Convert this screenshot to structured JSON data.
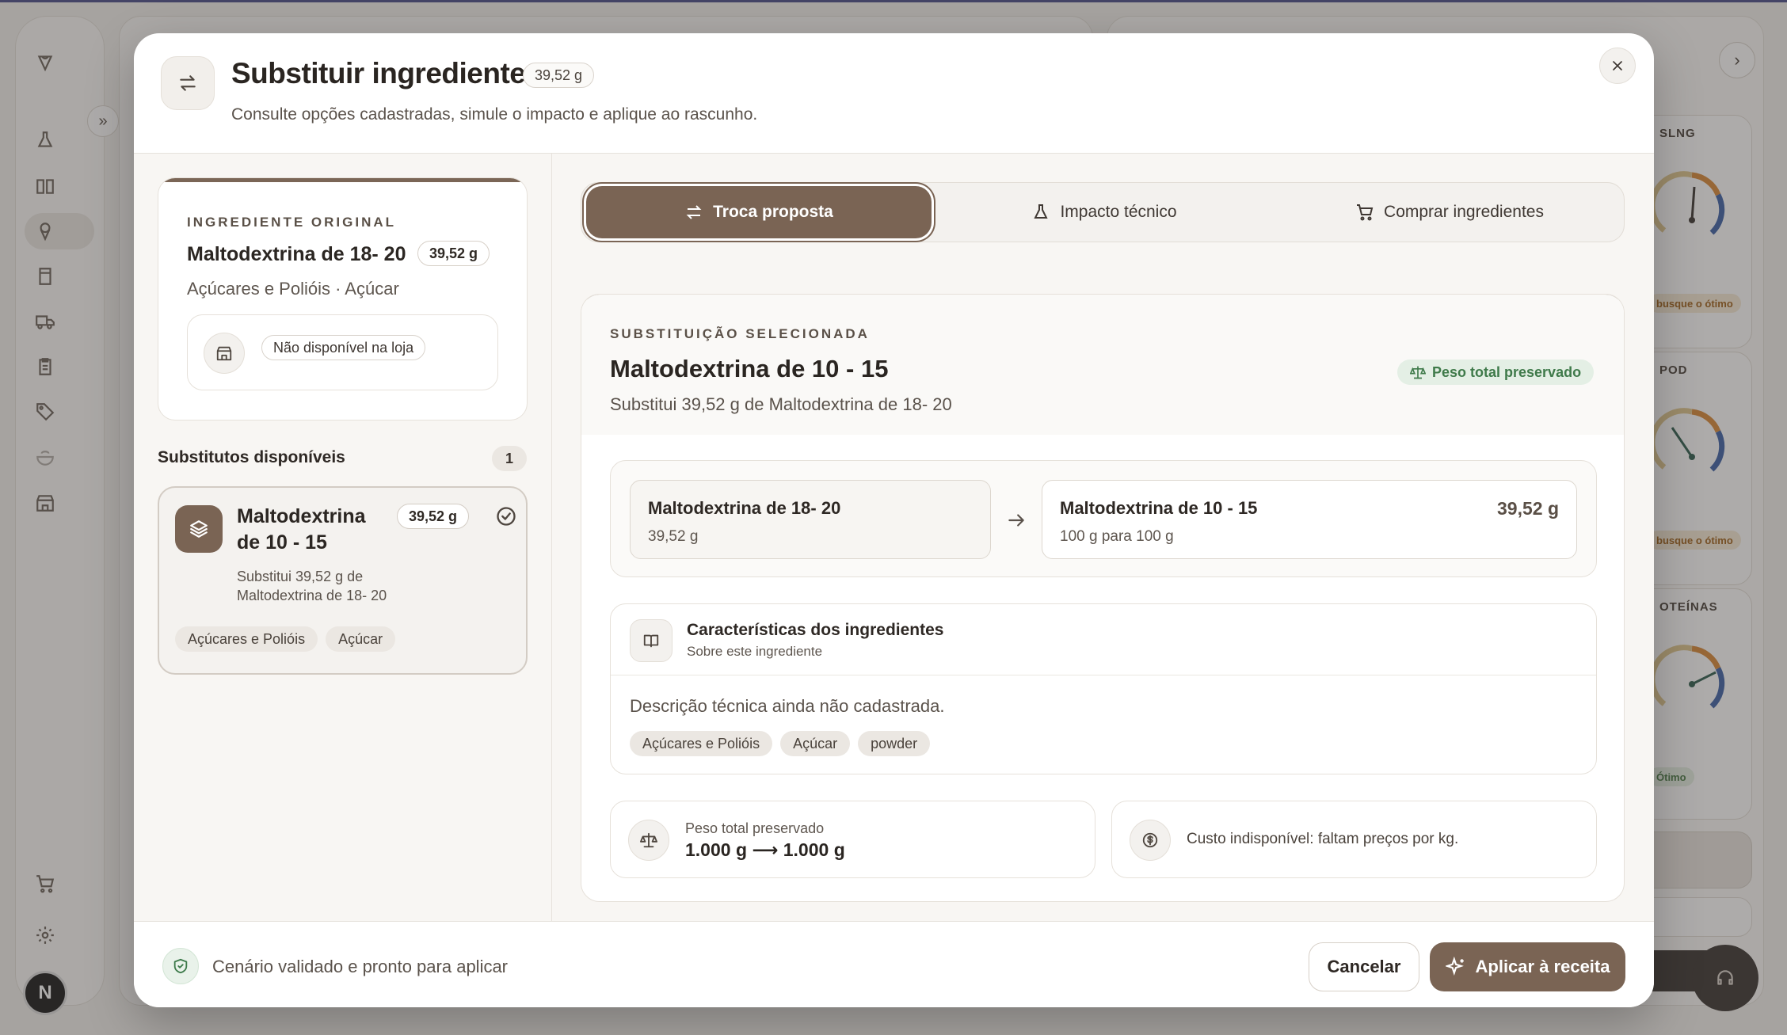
{
  "background": {
    "user_initial": "N",
    "side_panel": {
      "cards": [
        {
          "title": "SLNG",
          "gauge_value": "8.64",
          "gauge_ticks": [
            "8.5",
            "10"
          ],
          "status": "busque o ótimo"
        },
        {
          "title": "POD",
          "gauge_value": "169.07",
          "gauge_ticks": [
            "190",
            "200"
          ],
          "status": "busque o ótimo"
        },
        {
          "title": "OTEÍNAS",
          "gauge_value": "4.5",
          "gauge_ticks": [
            "3.5",
            "4.5",
            "5"
          ],
          "status": "Ótimo"
        }
      ]
    }
  },
  "modal": {
    "title": "Substituir ingrediente",
    "title_badge": "39,52 g",
    "subtitle": "Consulte opções cadastradas, simule o impacto e aplique ao rascunho.",
    "original": {
      "eyebrow": "INGREDIENTE ORIGINAL",
      "name": "Maltodextrina de 18- 20",
      "qty": "39,52 g",
      "category": "Açúcares e Polióis · Açúcar",
      "store_status": "Não disponível na loja"
    },
    "substitutes": {
      "title": "Substitutos disponíveis",
      "count": "1",
      "items": [
        {
          "name": "Maltodextrina de 10 - 15",
          "qty": "39,52 g",
          "description": "Substitui 39,52 g de Maltodextrina de 18- 20",
          "tags": [
            "Açúcares e Polióis",
            "Açúcar"
          ]
        }
      ]
    },
    "tabs": [
      {
        "label": "Troca proposta",
        "icon": "swap-icon",
        "active": true
      },
      {
        "label": "Impacto técnico",
        "icon": "flask-icon",
        "active": false
      },
      {
        "label": "Comprar ingredientes",
        "icon": "cart-icon",
        "active": false
      }
    ],
    "selected": {
      "eyebrow": "SUBSTITUIÇÃO SELECIONADA",
      "name": "Maltodextrina de 10 - 15",
      "subtitle": "Substitui 39,52 g de Maltodextrina de 18- 20",
      "preserved_badge": "Peso total preservado",
      "swap_from": {
        "name": "Maltodextrina de 18- 20",
        "qty": "39,52 g"
      },
      "swap_to": {
        "name": "Maltodextrina de 10 - 15",
        "ratio": "100 g para 100 g",
        "qty": "39,52 g"
      },
      "characteristics": {
        "title": "Características dos ingredientes",
        "subtitle": "Sobre este ingrediente",
        "description": "Descrição técnica ainda não cadastrada.",
        "tags": [
          "Açúcares e Polióis",
          "Açúcar",
          "powder"
        ]
      },
      "weight": {
        "label": "Peso total preservado",
        "value": "1.000 g ⟶ 1.000 g"
      },
      "cost": {
        "text": "Custo indisponível: faltam preços por kg."
      }
    },
    "footer": {
      "status": "Cenário validado e pronto para aplicar",
      "cancel_label": "Cancelar",
      "apply_label": "Aplicar à receita"
    }
  },
  "colors": {
    "accent": "#7a6454",
    "success": "#3f7a4a",
    "warning": "#a0621c"
  }
}
